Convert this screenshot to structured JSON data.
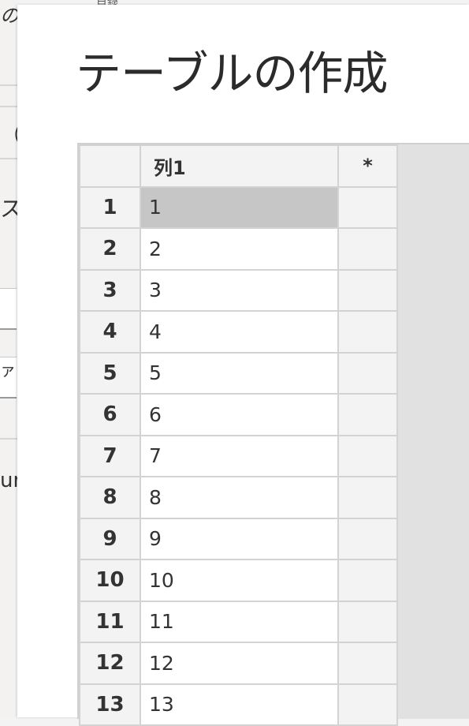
{
  "dialog": {
    "title": "テーブルの作成"
  },
  "background": {
    "fragments": [
      "の",
      "（",
      "ス",
      "ァ",
      "ur"
    ],
    "top_strip": [
      "目録"
    ]
  },
  "table": {
    "column_header": "列1",
    "add_column_label": "*",
    "selected_row": 1,
    "rows": [
      {
        "num": "1",
        "value": "1"
      },
      {
        "num": "2",
        "value": "2"
      },
      {
        "num": "3",
        "value": "3"
      },
      {
        "num": "4",
        "value": "4"
      },
      {
        "num": "5",
        "value": "5"
      },
      {
        "num": "6",
        "value": "6"
      },
      {
        "num": "7",
        "value": "7"
      },
      {
        "num": "8",
        "value": "8"
      },
      {
        "num": "9",
        "value": "9"
      },
      {
        "num": "10",
        "value": "10"
      },
      {
        "num": "11",
        "value": "11"
      },
      {
        "num": "12",
        "value": "12"
      },
      {
        "num": "13",
        "value": "13"
      }
    ]
  },
  "colors": {
    "selected_cell": "#c6c6c6",
    "header_bg": "#f3f3f3",
    "grid_border": "#d3d3d3"
  }
}
